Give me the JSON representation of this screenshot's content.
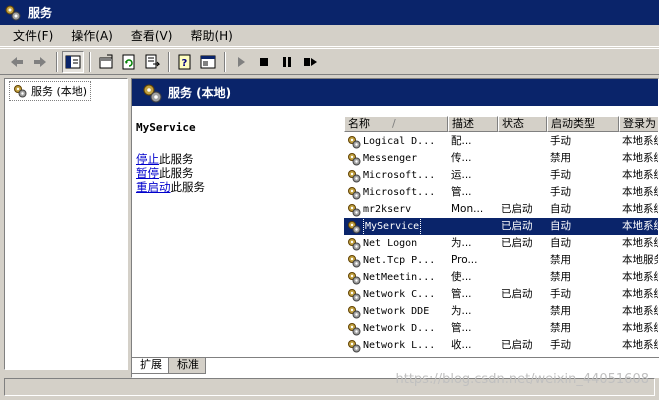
{
  "window": {
    "title": "服务"
  },
  "menu": [
    "文件(F)",
    "操作(A)",
    "查看(V)",
    "帮助(H)"
  ],
  "toolbar": {
    "buttons": [
      "back-arrow-icon",
      "forward-arrow-icon",
      "show-hide-tree-icon",
      "properties-icon",
      "refresh-icon",
      "export-list-icon",
      "help-icon",
      "console-icon",
      "play-icon",
      "stop-icon",
      "pause-icon",
      "restart-icon"
    ]
  },
  "tree": {
    "root_label": "服务 (本地)"
  },
  "pane": {
    "header": "服务 (本地)"
  },
  "detail": {
    "service_name": "MyService",
    "stop_link": "停止",
    "stop_suffix": "此服务",
    "pause_link": "暂停",
    "pause_suffix": "此服务",
    "restart_link": "重启动",
    "restart_suffix": "此服务"
  },
  "table": {
    "sort_indicator": "/",
    "columns": [
      "名称",
      "描述",
      "状态",
      "启动类型",
      "登录为"
    ],
    "rows": [
      {
        "name": "Logical D...",
        "desc": "配...",
        "status": "",
        "startup": "手动",
        "logon": "本地系统"
      },
      {
        "name": "Messenger",
        "desc": "传...",
        "status": "",
        "startup": "禁用",
        "logon": "本地系统"
      },
      {
        "name": "Microsoft...",
        "desc": "运...",
        "status": "",
        "startup": "手动",
        "logon": "本地系统"
      },
      {
        "name": "Microsoft...",
        "desc": "管...",
        "status": "",
        "startup": "手动",
        "logon": "本地系统"
      },
      {
        "name": "mr2kserv",
        "desc": "Mon...",
        "status": "已启动",
        "startup": "自动",
        "logon": "本地系统"
      },
      {
        "name": "MyService",
        "desc": "",
        "status": "已启动",
        "startup": "自动",
        "logon": "本地系统",
        "selected": true
      },
      {
        "name": "Net Logon",
        "desc": "为...",
        "status": "已启动",
        "startup": "自动",
        "logon": "本地系统"
      },
      {
        "name": "Net.Tcp P...",
        "desc": "Pro...",
        "status": "",
        "startup": "禁用",
        "logon": "本地服务"
      },
      {
        "name": "NetMeetin...",
        "desc": "使...",
        "status": "",
        "startup": "禁用",
        "logon": "本地系统"
      },
      {
        "name": "Network C...",
        "desc": "管...",
        "status": "已启动",
        "startup": "手动",
        "logon": "本地系统"
      },
      {
        "name": "Network DDE",
        "desc": "为...",
        "status": "",
        "startup": "禁用",
        "logon": "本地系统"
      },
      {
        "name": "Network D...",
        "desc": "管...",
        "status": "",
        "startup": "禁用",
        "logon": "本地系统"
      },
      {
        "name": "Network L...",
        "desc": "收...",
        "status": "已启动",
        "startup": "手动",
        "logon": "本地系统"
      },
      {
        "name": "",
        "desc": "",
        "status": "",
        "startup": "",
        "logon": ""
      }
    ]
  },
  "tabs": [
    "扩展",
    "标准"
  ],
  "watermark": "https://blog.csdn.net/weixin_44051608"
}
